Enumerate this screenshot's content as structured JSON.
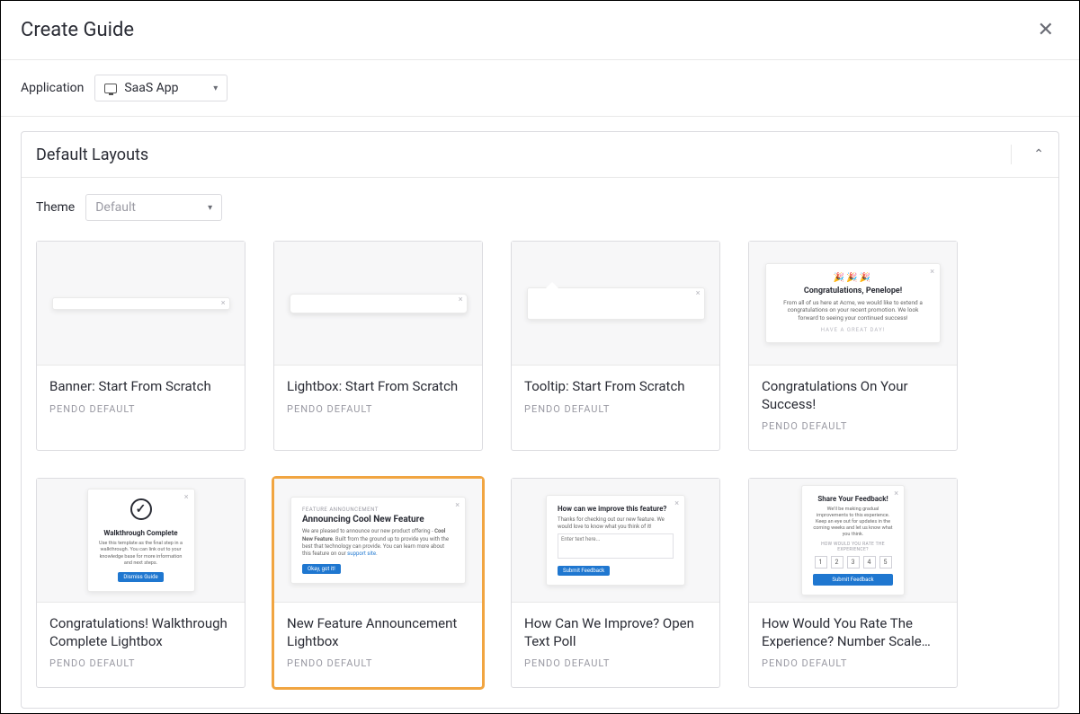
{
  "header": {
    "title": "Create Guide"
  },
  "application": {
    "label": "Application",
    "selected": "SaaS App"
  },
  "panel": {
    "title": "Default Layouts",
    "theme_label": "Theme",
    "theme_selected": "Default"
  },
  "cards": [
    {
      "title": "Banner: Start From Scratch",
      "sub": "PENDO DEFAULT",
      "thumb": "banner"
    },
    {
      "title": "Lightbox: Start From Scratch",
      "sub": "PENDO DEFAULT",
      "thumb": "lightbox"
    },
    {
      "title": "Tooltip: Start From Scratch",
      "sub": "PENDO DEFAULT",
      "thumb": "tooltip"
    },
    {
      "title": "Congratulations On Your Success!",
      "sub": "PENDO DEFAULT",
      "thumb": "congrats"
    },
    {
      "title": "Congratulations! Walkthrough Complete Lightbox",
      "sub": "PENDO DEFAULT",
      "thumb": "walkthrough"
    },
    {
      "title": "New Feature Announcement Lightbox",
      "sub": "PENDO DEFAULT",
      "thumb": "feature",
      "selected": true
    },
    {
      "title": "How Can We Improve? Open Text Poll",
      "sub": "PENDO DEFAULT",
      "thumb": "improve"
    },
    {
      "title": "How Would You Rate The Experience? Number Scale…",
      "sub": "PENDO DEFAULT",
      "thumb": "rate"
    }
  ],
  "thumbs": {
    "congrats": {
      "emoji": "🎉🎉🎉",
      "title": "Congratulations, Penelope!",
      "body": "From all of us here at Acme, we would like to extend a congratulations on your recent promotion. We look forward to seeing your continued success!",
      "footer": "HAVE A GREAT DAY!"
    },
    "walkthrough": {
      "title": "Walkthrough Complete",
      "body": "Use this template as the final step in a walkthrough. You can link out to your knowledge base for more information and next steps.",
      "button": "Dismiss Guide"
    },
    "feature": {
      "tag": "FEATURE ANNOUNCEMENT",
      "title": "Announcing Cool New Feature",
      "body_prefix": "We are pleased to announce our new product offering - ",
      "body_bold": "Cool New Feature",
      "body_suffix": ". Built from the ground up to provide you with the best that technology can provide. You can learn more about this feature on our ",
      "body_link": "support site",
      "button": "Okay, got it!"
    },
    "improve": {
      "title": "How can we improve this feature?",
      "body": "Thanks for checking out our new feature. We would love to know what you think of it!",
      "placeholder": "Enter text here...",
      "button": "Submit Feedback"
    },
    "rate": {
      "title": "Share Your Feedback!",
      "body": "We'll be making gradual improvements to this experience. Keep an eye out for updates in the coming weeks and let us know what you think.",
      "prompt": "HOW WOULD YOU RATE THE EXPERIENCE?",
      "scale": [
        "1",
        "2",
        "3",
        "4",
        "5"
      ],
      "button": "Submit Feedback"
    }
  }
}
